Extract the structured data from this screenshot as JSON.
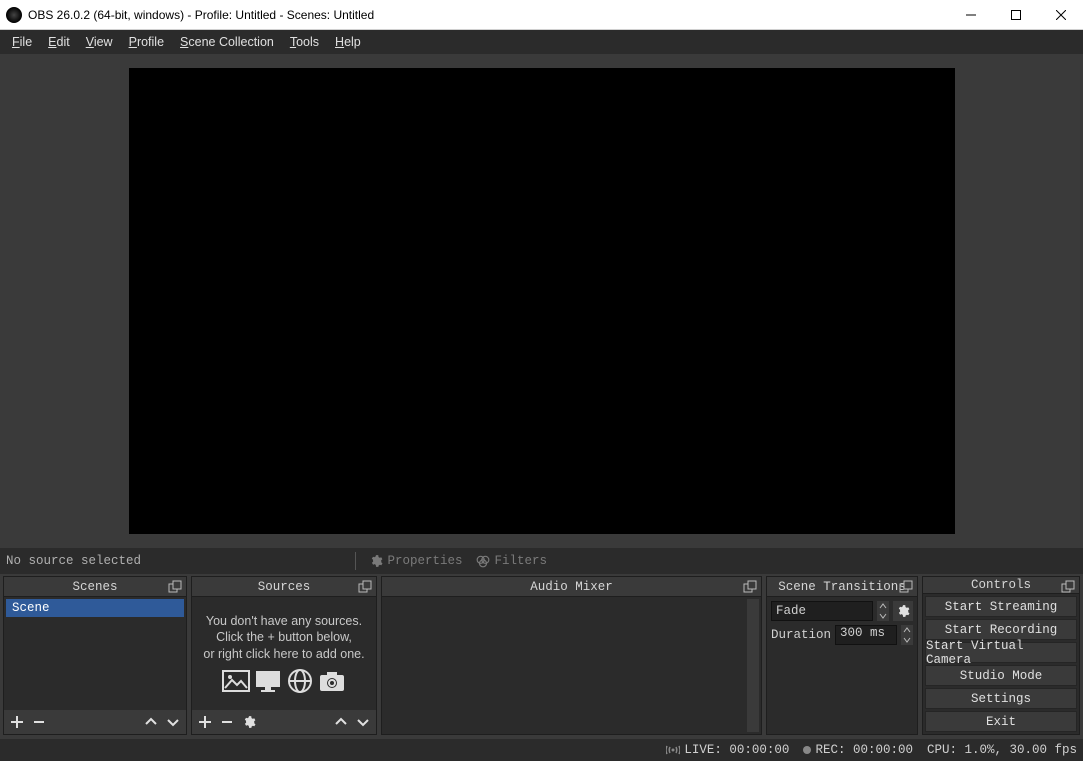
{
  "titlebar": {
    "title": "OBS 26.0.2 (64-bit, windows) - Profile: Untitled - Scenes: Untitled"
  },
  "menubar": {
    "items": [
      "File",
      "Edit",
      "View",
      "Profile",
      "Scene Collection",
      "Tools",
      "Help"
    ]
  },
  "src_toolbar": {
    "status": "No source selected",
    "properties": "Properties",
    "filters": "Filters"
  },
  "docks": {
    "scenes": {
      "title": "Scenes",
      "items": [
        "Scene"
      ]
    },
    "sources": {
      "title": "Sources",
      "empty_l1": "You don't have any sources.",
      "empty_l2": "Click the + button below,",
      "empty_l3": "or right click here to add one."
    },
    "mixer": {
      "title": "Audio Mixer"
    },
    "transitions": {
      "title": "Scene Transitions",
      "selected": "Fade",
      "duration_label": "Duration",
      "duration_value": "300 ms"
    },
    "controls": {
      "title": "Controls",
      "buttons": [
        "Start Streaming",
        "Start Recording",
        "Start Virtual Camera",
        "Studio Mode",
        "Settings",
        "Exit"
      ]
    }
  },
  "statusbar": {
    "live": "LIVE: 00:00:00",
    "rec": "REC: 00:00:00",
    "cpu": "CPU: 1.0%, 30.00 fps"
  }
}
